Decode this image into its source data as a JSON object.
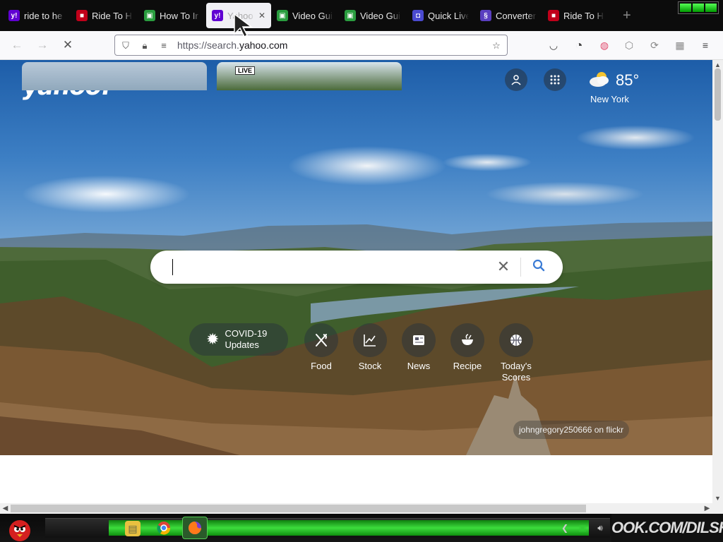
{
  "browser": {
    "tabs": [
      {
        "label": "ride to he",
        "icon": "yahoo-icon",
        "icon_color": "#6001d2",
        "icon_text": "y!"
      },
      {
        "label": "Ride To H",
        "icon": "gamepad-icon",
        "icon_color": "#c0001a",
        "icon_text": "⬛"
      },
      {
        "label": "How To Ir",
        "icon": "cube-icon",
        "icon_color": "#2a9d3f",
        "icon_text": "▣"
      },
      {
        "label": "Yahoo",
        "icon": "yahoo-icon",
        "icon_color": "#6001d2",
        "icon_text": "y!",
        "active": true
      },
      {
        "label": "Video Gui",
        "icon": "cube-icon",
        "icon_color": "#2a9d3f",
        "icon_text": "▣"
      },
      {
        "label": "Video Gui",
        "icon": "cube-icon",
        "icon_color": "#2a9d3f",
        "icon_text": "▣"
      },
      {
        "label": "Quick Live",
        "icon": "app-icon",
        "icon_color": "#4a4ad0",
        "icon_text": "◘"
      },
      {
        "label": "Converter",
        "icon": "convert-icon",
        "icon_color": "#5a3fc0",
        "icon_text": "§"
      },
      {
        "label": "Ride To H",
        "icon": "gamepad-icon",
        "icon_color": "#c0001a",
        "icon_text": "⬛"
      }
    ],
    "new_tab_symbol": "+",
    "close_symbol": "✕",
    "url_prefix": "https://search.",
    "url_domain": "yahoo.com",
    "url_suffix": ""
  },
  "page": {
    "logo": "yahoo!",
    "weather": {
      "temp": "85°",
      "city": "New York"
    },
    "search": {
      "value": "",
      "clear_symbol": "✕"
    },
    "covid": {
      "line1": "COVID-19",
      "line2": "Updates"
    },
    "quick_links": [
      {
        "label": "Food",
        "icon": "fork-knife-icon",
        "glyph": "✕"
      },
      {
        "label": "Stock",
        "icon": "chart-icon",
        "glyph": "📈"
      },
      {
        "label": "News",
        "icon": "newspaper-icon",
        "glyph": "▤"
      },
      {
        "label": "Recipe",
        "icon": "bowl-icon",
        "glyph": "◒"
      },
      {
        "label": "Today's Scores",
        "icon": "basketball-icon",
        "glyph": "◍"
      }
    ],
    "photo_credit": "johngregory250666 on flickr",
    "live_badge": "LIVE"
  },
  "taskbar": {
    "banner_text": "OOK.COM/DILSHADS"
  },
  "colors": {
    "accent": "#3a7bd5",
    "yahoo_purple": "#6001d2"
  }
}
